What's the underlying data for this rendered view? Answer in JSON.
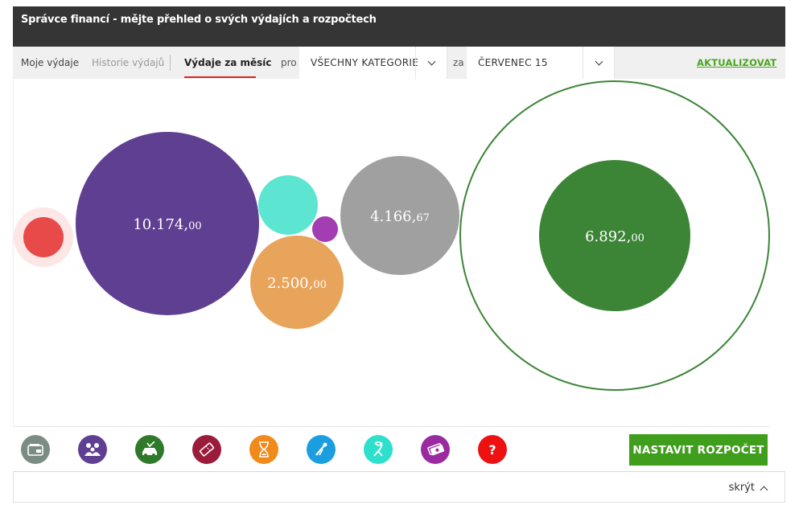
{
  "header": {
    "title": "Správce financí - mějte přehled o svých výdajích a rozpočtech"
  },
  "tabs": {
    "my_expenses": "Moje výdaje",
    "history": "Historie výdajů",
    "monthly": "Výdaje za měsíc"
  },
  "filters": {
    "pro_label": "pro",
    "category_value": "VŠECHNY KATEGORIE",
    "za_label": "za",
    "month_value": "ČERVENEC 15",
    "update_label": "AKTUALIZOVAT"
  },
  "chart_data": {
    "type": "bubble",
    "bubbles": [
      {
        "name": "red",
        "color": "#e84a4a",
        "value": null,
        "label_int": "",
        "label_dec": ""
      },
      {
        "name": "purple",
        "color": "#5f3f91",
        "value": 10174.0,
        "label_int": "10.174,",
        "label_dec": "00"
      },
      {
        "name": "turquoise",
        "color": "#5ce6d2",
        "value": null,
        "label_int": "",
        "label_dec": ""
      },
      {
        "name": "orange",
        "color": "#e8a45a",
        "value": 2500.0,
        "label_int": "2.500,",
        "label_dec": "00"
      },
      {
        "name": "magenta",
        "color": "#a23db2",
        "value": null,
        "label_int": "",
        "label_dec": ""
      },
      {
        "name": "gray",
        "color": "#a0a0a0",
        "value": 4166.67,
        "label_int": "4.166,",
        "label_dec": "67"
      },
      {
        "name": "green",
        "color": "#3c8537",
        "value": 6892.0,
        "label_int": "6.892,",
        "label_dec": "00"
      }
    ]
  },
  "categories": [
    {
      "name": "wallet-icon",
      "color": "#7a8c83"
    },
    {
      "name": "family-icon",
      "color": "#5f3f91"
    },
    {
      "name": "car-icon",
      "color": "#2f7a2a"
    },
    {
      "name": "ticket-icon",
      "color": "#9b1b3a"
    },
    {
      "name": "hourglass-icon",
      "color": "#f08a1a"
    },
    {
      "name": "tools-icon",
      "color": "#1a9ee0"
    },
    {
      "name": "ribbon-icon",
      "color": "#2de0cc"
    },
    {
      "name": "money-icon",
      "color": "#9a2aa0"
    },
    {
      "name": "question-icon",
      "color": "#ee1111"
    }
  ],
  "actions": {
    "set_budget": "NASTAVIT ROZPOČET"
  },
  "footer": {
    "hide_label": "skrýt"
  }
}
